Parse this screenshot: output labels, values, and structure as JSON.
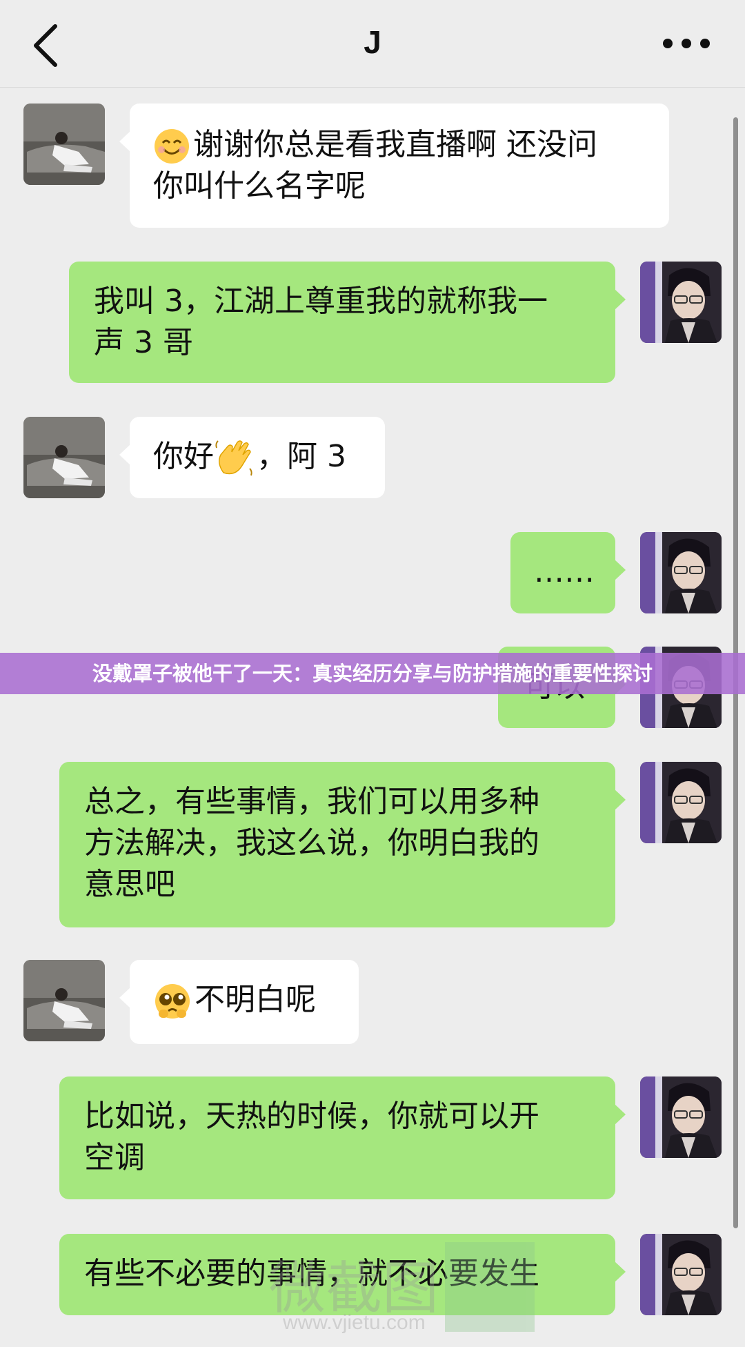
{
  "header": {
    "title": "J",
    "back_icon": "chevron-left-icon",
    "more_icon": "ellipsis-icon"
  },
  "messages": [
    {
      "side": "in",
      "emoji": "smiling-face-emoji",
      "line1": "谢谢你总是看我直播啊 还没问",
      "line2": "你叫什么名字呢"
    },
    {
      "side": "out",
      "line1": "我叫 3，江湖上尊重我的就称我一",
      "line2": "声 3 哥"
    },
    {
      "side": "in",
      "pre": "你好",
      "emoji": "waving-hand-emoji",
      "post": "，阿 3"
    },
    {
      "side": "out",
      "text": "……"
    },
    {
      "side": "out",
      "text": "可以"
    },
    {
      "side": "out",
      "line1": "总之，有些事情，我们可以用多种",
      "line2": "方法解决，我这么说，你明白我的",
      "line3": "意思吧"
    },
    {
      "side": "in",
      "emoji": "pleading-face-emoji",
      "text": "不明白呢"
    },
    {
      "side": "out",
      "line1": "比如说，天热的时候，你就可以开",
      "line2": "空调"
    },
    {
      "side": "out",
      "text": "有些不必要的事情，就不必要发生"
    }
  ],
  "banner": {
    "text": "没戴罩子被他干了一天：真实经历分享与防护措施的重要性探讨"
  },
  "watermark": {
    "text": "微截图",
    "url": "www.vjietu.com"
  },
  "colors": {
    "background": "#ededed",
    "outgoing_bubble": "#a5e77e",
    "incoming_bubble": "#ffffff",
    "banner": "#aa6ed2"
  }
}
